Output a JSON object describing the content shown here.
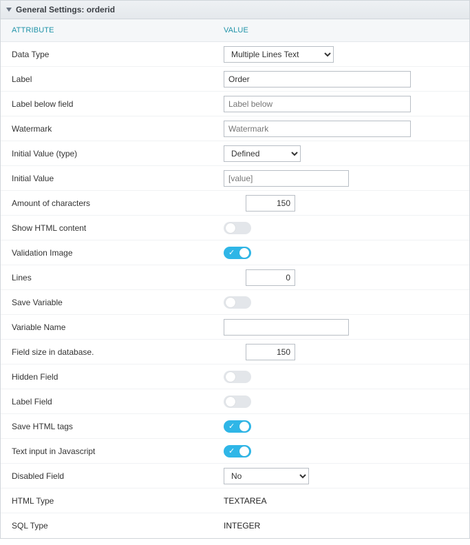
{
  "panel": {
    "title": "General Settings: orderid"
  },
  "headers": {
    "attribute": "Attribute",
    "value": "Value"
  },
  "rows": {
    "data_type": {
      "label": "Data Type",
      "value": "Multiple Lines Text"
    },
    "label": {
      "label": "Label",
      "value": "Order"
    },
    "label_below": {
      "label": "Label below field",
      "placeholder": "Label below",
      "value": ""
    },
    "watermark": {
      "label": "Watermark",
      "placeholder": "Watermark",
      "value": ""
    },
    "initial_value_type": {
      "label": "Initial Value (type)",
      "value": "Defined"
    },
    "initial_value": {
      "label": "Initial Value",
      "placeholder": "[value]",
      "value": ""
    },
    "amount_chars": {
      "label": "Amount of characters",
      "value": "150"
    },
    "show_html": {
      "label": "Show HTML content",
      "on": false
    },
    "validation_image": {
      "label": "Validation Image",
      "on": true
    },
    "lines": {
      "label": "Lines",
      "value": "0"
    },
    "save_variable": {
      "label": "Save Variable",
      "on": false
    },
    "variable_name": {
      "label": "Variable Name",
      "value": ""
    },
    "field_size_db": {
      "label": "Field size in database.",
      "value": "150"
    },
    "hidden_field": {
      "label": "Hidden Field",
      "on": false
    },
    "label_field": {
      "label": "Label Field",
      "on": false
    },
    "save_html_tags": {
      "label": "Save HTML tags",
      "on": true
    },
    "text_input_js": {
      "label": "Text input in Javascript",
      "on": true
    },
    "disabled_field": {
      "label": "Disabled Field",
      "value": "No"
    },
    "html_type": {
      "label": "HTML Type",
      "value": "TEXTAREA"
    },
    "sql_type": {
      "label": "SQL Type",
      "value": "INTEGER"
    }
  }
}
